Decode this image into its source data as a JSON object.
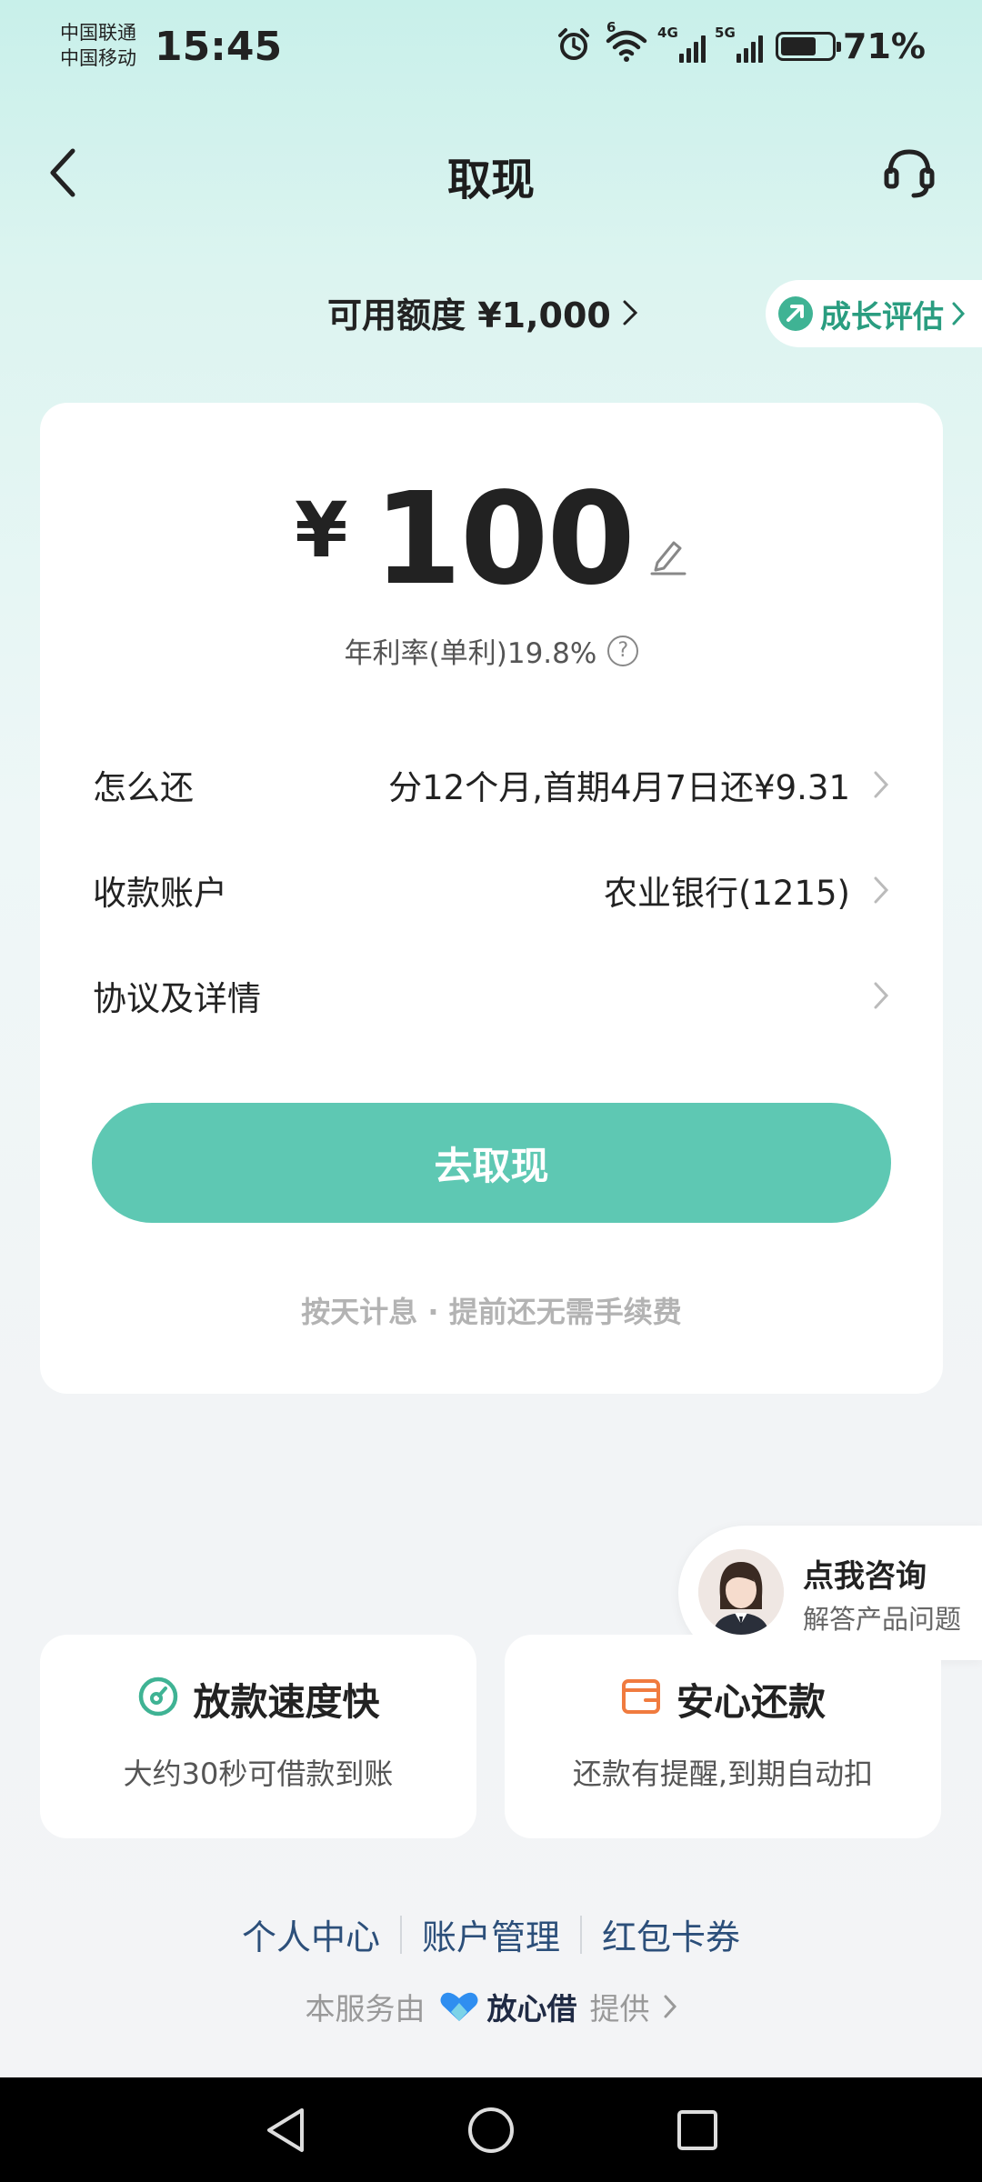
{
  "status_bar": {
    "carrier_1": "中国联通",
    "carrier_2": "中国移动",
    "time": "15:45",
    "signal_1_label": "4G",
    "signal_2_label": "5G",
    "wifi_label": "6",
    "battery_percent": "71%",
    "battery_level": 0.71
  },
  "header": {
    "title": "取现",
    "back_icon": "chevron-left-icon",
    "service_icon": "headset-icon"
  },
  "credit": {
    "label": "可用额度 ¥1,000",
    "growth_label": "成长评估"
  },
  "loan": {
    "currency": "¥",
    "amount": "100",
    "rate_text": "年利率(单利)19.8%",
    "rows": [
      {
        "label": "怎么还",
        "value": "分12个月,首期4月7日还¥9.31"
      },
      {
        "label": "收款账户",
        "value": "农业银行(1215)"
      },
      {
        "label": "协议及详情",
        "value": ""
      }
    ],
    "submit_label": "去取现",
    "note": "按天计息 · 提前还无需手续费"
  },
  "consult": {
    "title": "点我咨询",
    "subtitle": "解答产品问题"
  },
  "features": [
    {
      "title": "放款速度快",
      "desc": "大约30秒可借款到账",
      "icon": "speed-icon"
    },
    {
      "title": "安心还款",
      "desc": "还款有提醒,到期自动扣",
      "icon": "wallet-icon"
    }
  ],
  "footer": {
    "links": [
      "个人中心",
      "账户管理",
      "红包卡券"
    ],
    "provider_prefix": "本服务由",
    "provider_brand": "放心借",
    "provider_suffix": "提供"
  },
  "colors": {
    "accent": "#5ec8b3",
    "growth": "#3fb394",
    "link": "#2c4f7a"
  }
}
